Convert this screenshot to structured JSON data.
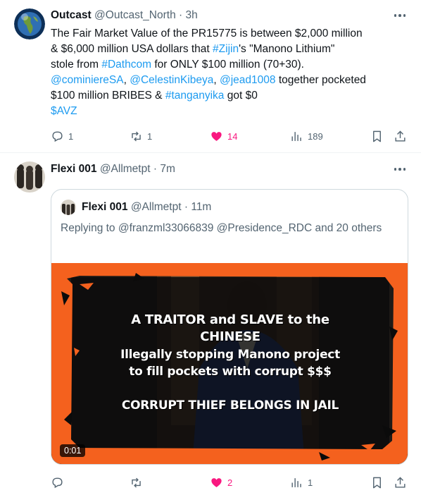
{
  "tweet1": {
    "name": "Outcast",
    "handle": "@Outcast_North",
    "time": "3h",
    "text": {
      "line1": "The Fair Market Value of the PR15775 is between $2,000 million",
      "line2_a": "& $6,000 million USA dollars that ",
      "line2_tag": "#Zijin",
      "line2_b": "'s  \"Manono Lithium\"",
      "line3_a": "stole from ",
      "line3_tag": "#Dathcom",
      "line3_b": " for ONLY $100 million (70+30).",
      "line4_m1": "@cominiereSA",
      "line4_s1": ", ",
      "line4_m2": "@CelestinKibeya",
      "line4_s2": ", ",
      "line4_m3": "@jead1008",
      "line4_b": " together pocketed",
      "line5_a": "$100 million BRIBES & ",
      "line5_tag": "#tanganyika",
      "line5_b": " got $0",
      "line6_cashtag": "$AVZ"
    },
    "replies": "1",
    "reposts": "1",
    "likes": "14",
    "views": "189"
  },
  "tweet2": {
    "name": "Flexi 001",
    "handle": "@Allmetpt",
    "time": "7m",
    "replies": "",
    "reposts": "",
    "likes": "2",
    "views": "1"
  },
  "quoted": {
    "name": "Flexi 001",
    "handle": "@Allmetpt",
    "time": "11m",
    "reply_prefix": "Replying to ",
    "reply_mentions": "@franzml33066839 @Presidence_RDC",
    "reply_suffix": " and 20 others",
    "video_time": "0:01",
    "overlay": {
      "line1": "A TRAITOR and SLAVE to the",
      "line2": "CHINESE",
      "line3": "Illegally stopping Manono project",
      "line4": "to fill pockets with corrupt $$$",
      "line5": "CORRUPT THIEF BELONGS IN JAIL"
    }
  },
  "colors": {
    "accent": "#1d9bf0",
    "like": "#f91880",
    "muted": "#536471",
    "frame_orange": "#f4611e"
  },
  "icons": [
    "reply-icon",
    "repost-icon",
    "heart-icon",
    "views-icon",
    "bookmark-icon",
    "share-icon",
    "more-icon"
  ]
}
